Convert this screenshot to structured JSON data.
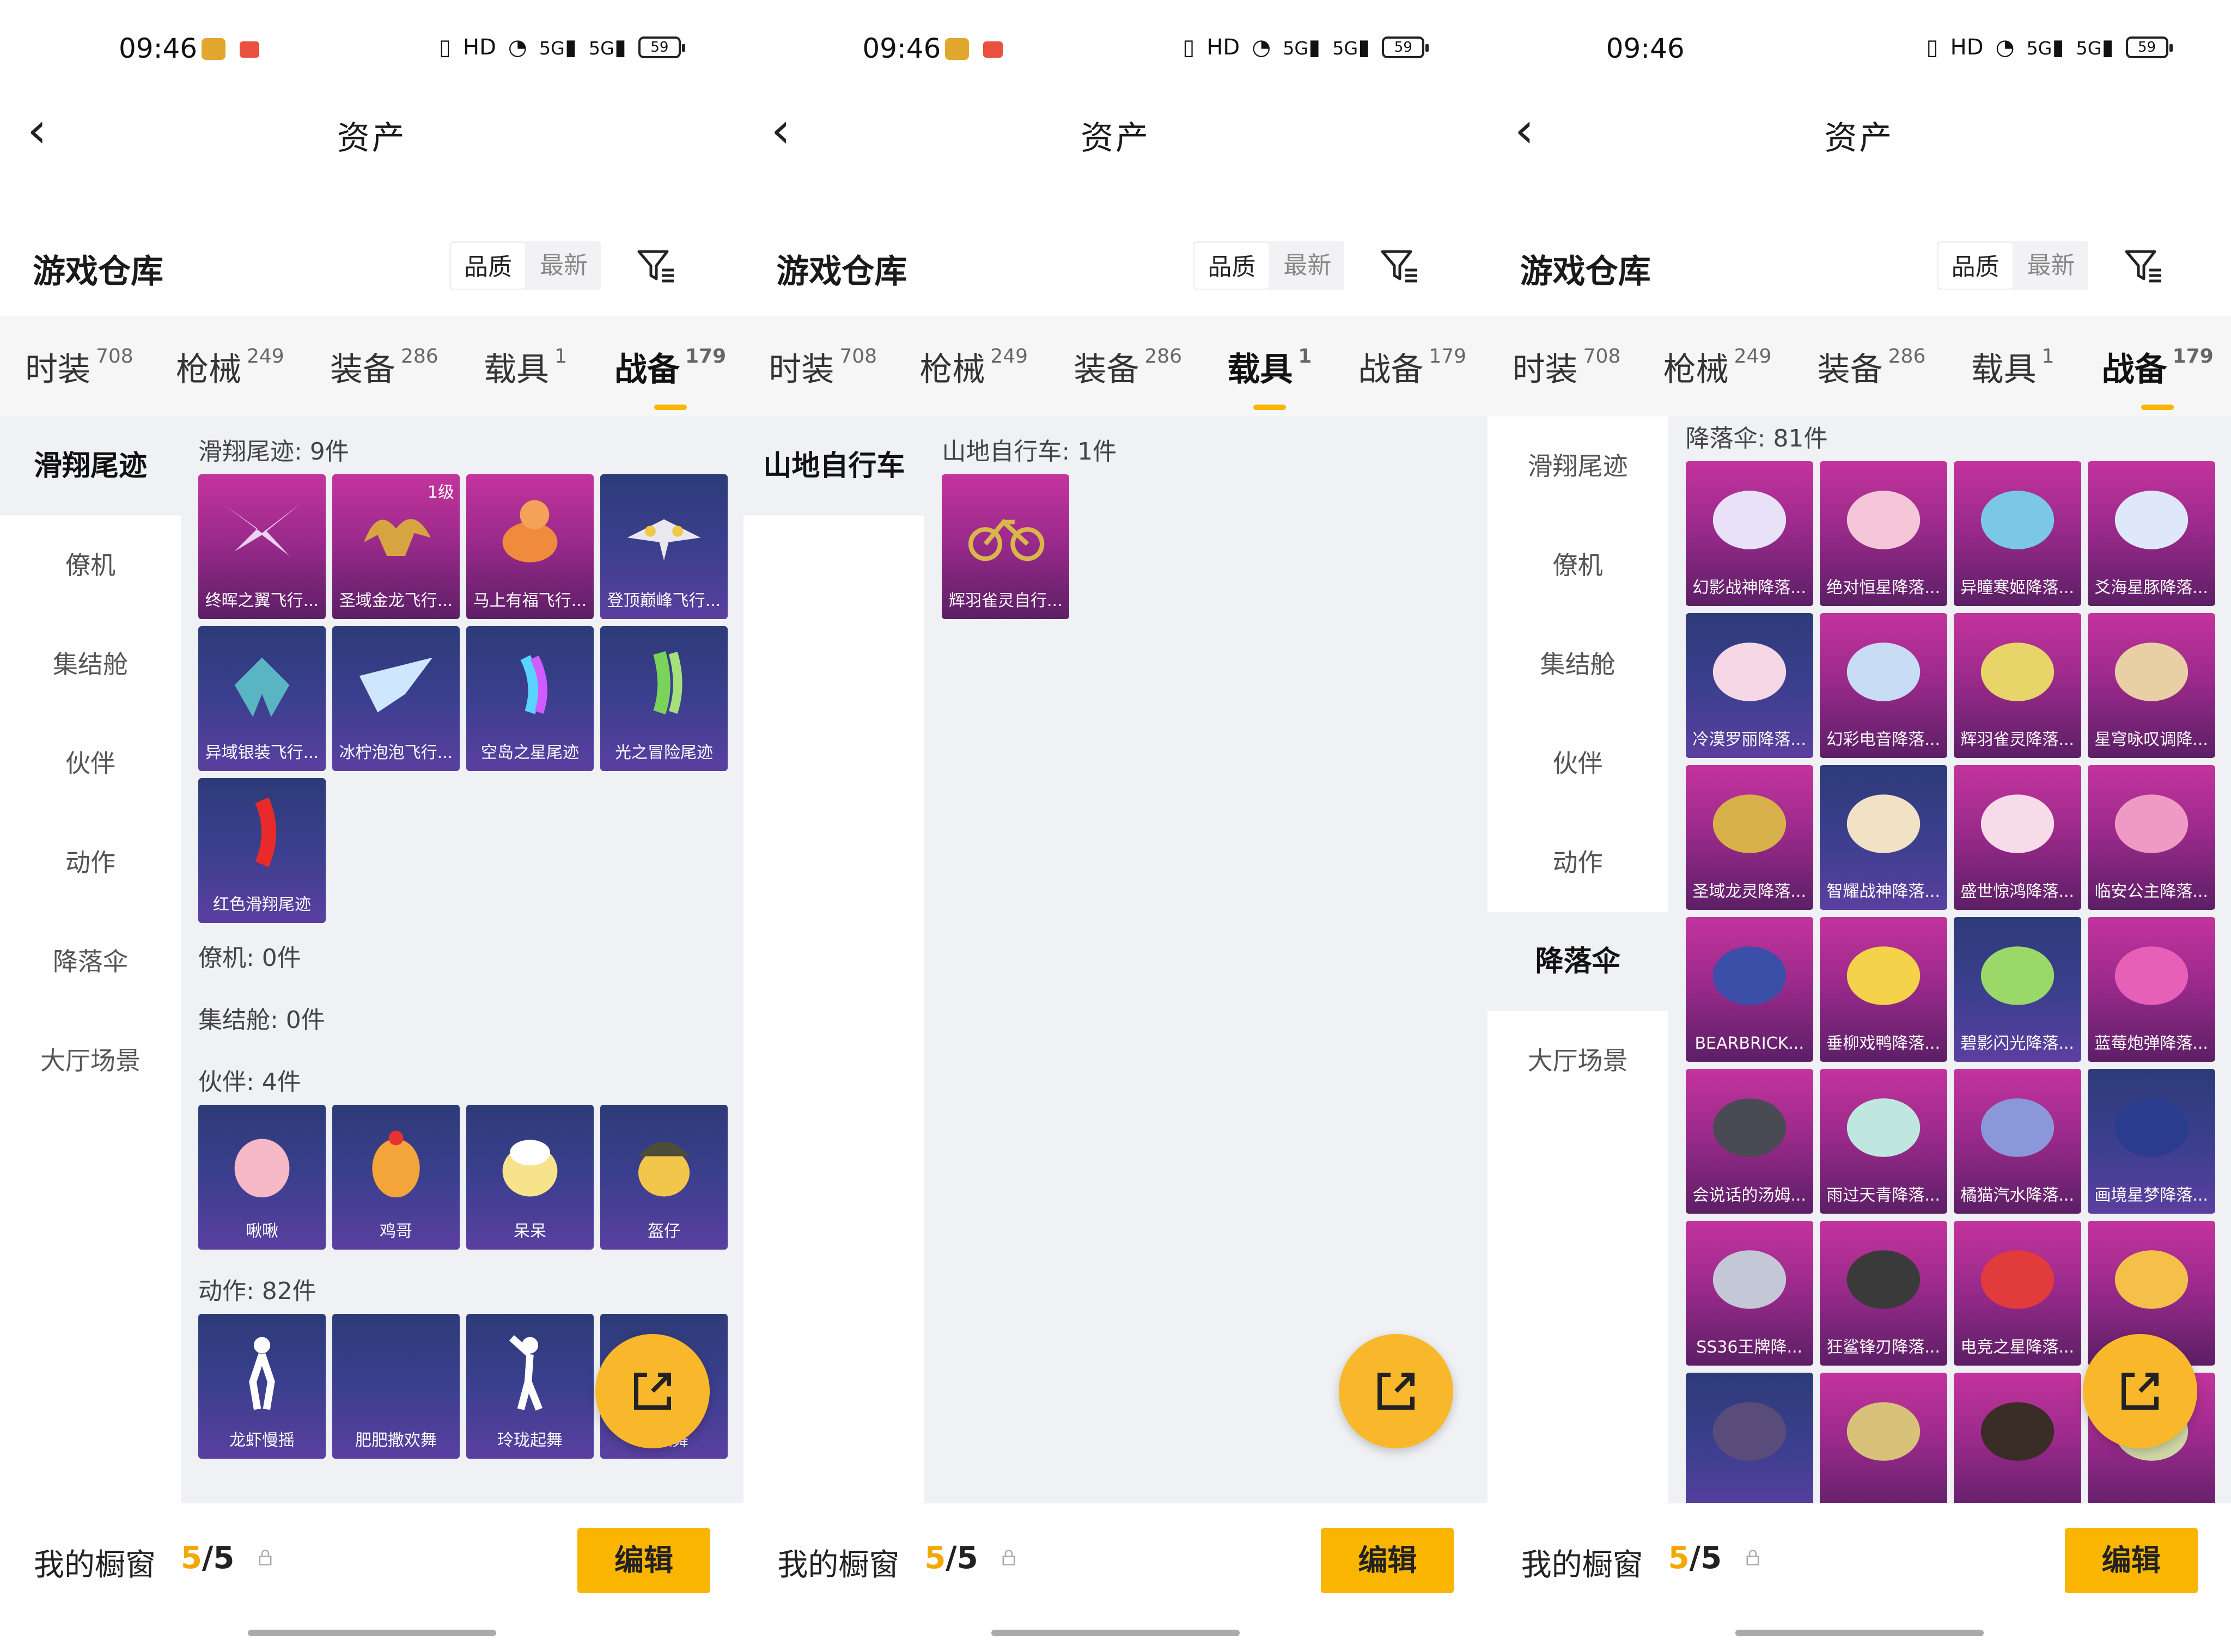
{
  "status": {
    "time": "09:46",
    "signal_a": "5G",
    "signal_b": "5G",
    "battery": "59"
  },
  "header": {
    "back_icon": "back-arrow-icon",
    "title": "资产"
  },
  "warehouse": {
    "title": "游戏仓库",
    "sort_quality": "品质",
    "sort_newest": "最新",
    "filter_icon": "filter-icon"
  },
  "tabs": [
    {
      "label": "时装",
      "count": "708"
    },
    {
      "label": "枪械",
      "count": "249"
    },
    {
      "label": "装备",
      "count": "286"
    },
    {
      "label": "载具",
      "count": "1"
    },
    {
      "label": "战备",
      "count": "179"
    }
  ],
  "sidebar_zhanbei": [
    "滑翔尾迹",
    "僚机",
    "集结舱",
    "伙伴",
    "动作",
    "降落伞",
    "大厅场景"
  ],
  "sidebar_zaiju": [
    "山地自行车"
  ],
  "panel1": {
    "glide_title": "滑翔尾迹: 9件",
    "glide_items": [
      {
        "name": "终晖之翼飞行...",
        "level": ""
      },
      {
        "name": "圣域金龙飞行...",
        "level": "1级"
      },
      {
        "name": "马上有福飞行...",
        "level": ""
      },
      {
        "name": "登顶巅峰飞行...",
        "level": ""
      },
      {
        "name": "异域银装飞行...",
        "level": ""
      },
      {
        "name": "冰柠泡泡飞行...",
        "level": ""
      },
      {
        "name": "空岛之星尾迹",
        "level": ""
      },
      {
        "name": "光之冒险尾迹",
        "level": ""
      },
      {
        "name": "红色滑翔尾迹",
        "level": ""
      }
    ],
    "wingman_title": "僚机: 0件",
    "pod_title": "集结舱: 0件",
    "partner_title": "伙伴: 4件",
    "partner_items": [
      "啾啾",
      "鸡哥",
      "呆呆",
      "盔仔"
    ],
    "emote_title": "动作: 82件",
    "emote_items": [
      "龙虾慢摇",
      "肥肥撒欢舞",
      "玲珑起舞",
      "打歌舞"
    ]
  },
  "panel2": {
    "bike_title": "山地自行车: 1件",
    "bike_items": [
      "辉羽雀灵自行..."
    ]
  },
  "panel3": {
    "para_title": "降落伞: 81件",
    "para_items": [
      "幻影战神降落...",
      "绝对恒星降落...",
      "异瞳寒姬降落...",
      "爻海星豚降落...",
      "冷漠罗丽降落...",
      "幻彩电音降落...",
      "辉羽雀灵降落...",
      "星穹咏叹调降...",
      "圣域龙灵降落...",
      "智耀战神降落...",
      "盛世惊鸿降落...",
      "临安公主降落...",
      "BEARBRICK...",
      "垂柳戏鸭降落...",
      "碧影闪光降落...",
      "蓝莓炮弹降落...",
      "会说话的汤姆...",
      "雨过天青降落...",
      "橘猫汽水降落...",
      "画境星梦降落...",
      "SS36王牌降...",
      "狂鲨锋刃降落...",
      "电竞之星降落...",
      "...伞",
      "",
      "",
      "",
      ""
    ]
  },
  "bottom": {
    "label": "我的橱窗",
    "current": "5",
    "total": "/5",
    "lock_icon": "lock-icon",
    "edit": "编辑"
  },
  "fab_icon": "share-external-icon",
  "colors": {
    "accent": "#f9b500",
    "rare_card": "#9c2a8c",
    "epic_card": "#3b3f8e"
  }
}
